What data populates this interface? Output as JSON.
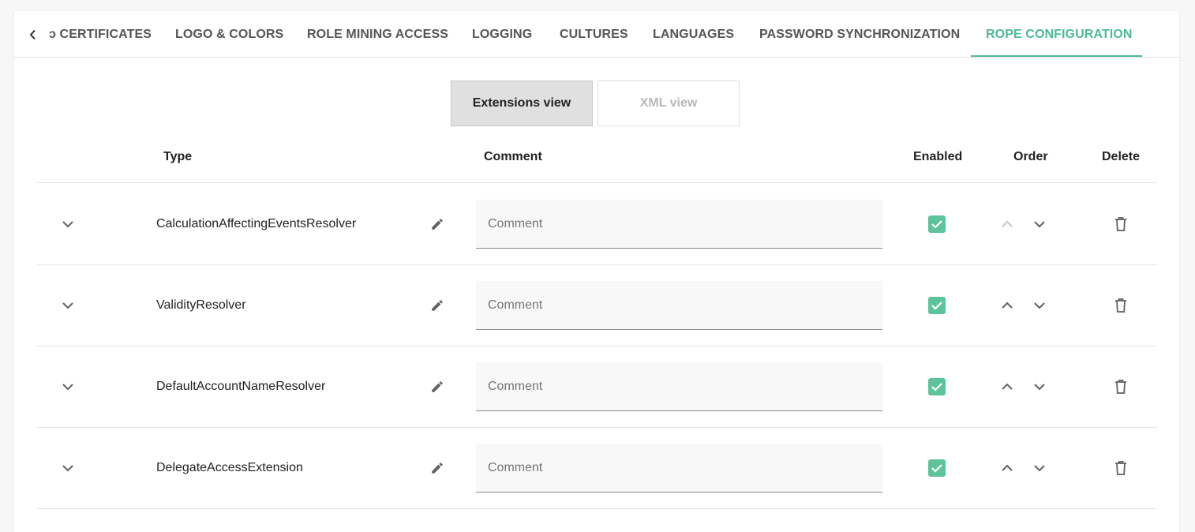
{
  "tabs": [
    {
      "label": "CERTIFICATES",
      "active": false
    },
    {
      "label": "LOGO & COLORS",
      "active": false
    },
    {
      "label": "ROLE MINING ACCESS",
      "active": false
    },
    {
      "label": "LOGGING",
      "active": false
    },
    {
      "label": "CULTURES",
      "active": false
    },
    {
      "label": "LANGUAGES",
      "active": false
    },
    {
      "label": "PASSWORD SYNCHRONIZATION",
      "active": false
    },
    {
      "label": "ROPE CONFIGURATION",
      "active": true
    }
  ],
  "views": {
    "extensions_label": "Extensions view",
    "xml_label": "XML view",
    "selected": "Extensions view"
  },
  "table": {
    "headers": {
      "type": "Type",
      "comment": "Comment",
      "enabled": "Enabled",
      "order": "Order",
      "delete": "Delete"
    },
    "rows": [
      {
        "type": "CalculationAffectingEventsResolver",
        "comment_value": "",
        "comment_placeholder": "Comment",
        "enabled": true,
        "up_disabled": true
      },
      {
        "type": "ValidityResolver",
        "comment_value": "",
        "comment_placeholder": "Comment",
        "enabled": true,
        "up_disabled": false
      },
      {
        "type": "DefaultAccountNameResolver",
        "comment_value": "",
        "comment_placeholder": "Comment",
        "enabled": true,
        "up_disabled": false
      },
      {
        "type": "DelegateAccessExtension",
        "comment_value": "",
        "comment_placeholder": "Comment",
        "enabled": true,
        "up_disabled": false
      }
    ]
  },
  "colors": {
    "accent": "#4dbb96",
    "checkbox": "#5cc39c",
    "icon": "#616161",
    "icon_disabled": "#c4c4c4"
  },
  "icons": {
    "tab_scroll": "chevron-left-icon",
    "expand": "chevron-down-icon",
    "edit": "pencil-icon",
    "enabled": "checkbox-checked-icon",
    "order_up": "chevron-up-icon",
    "order_down": "chevron-down-icon",
    "delete": "trash-icon"
  }
}
